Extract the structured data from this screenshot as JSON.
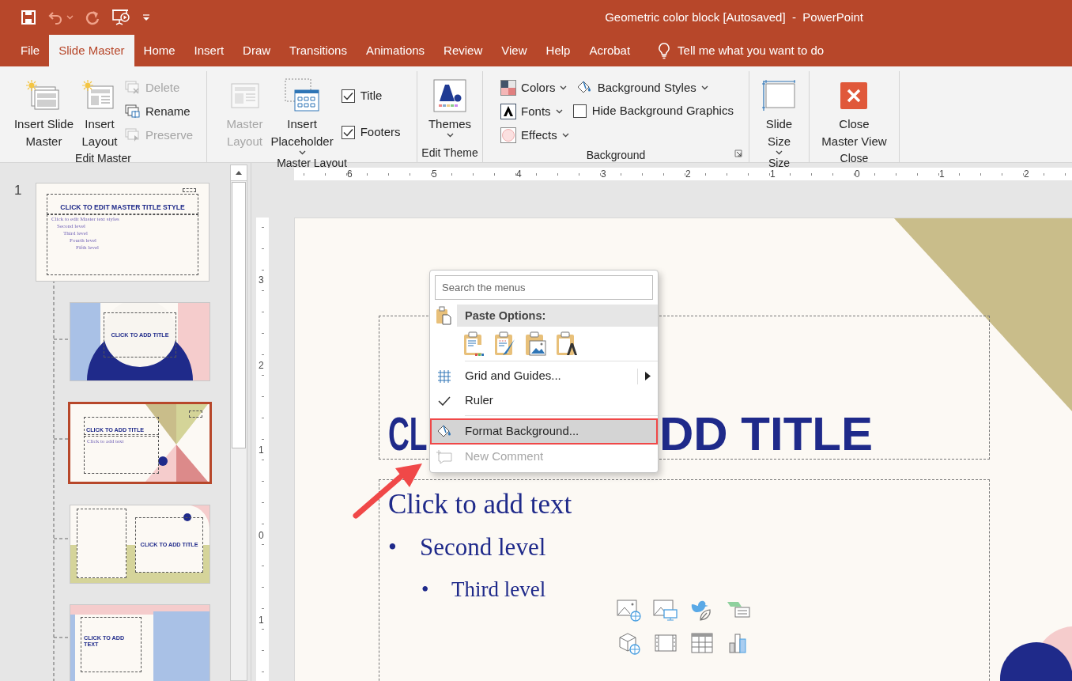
{
  "window": {
    "title": "Geometric color block [Autosaved]  -  PowerPoint"
  },
  "quick_access": [
    {
      "kind": "save",
      "disabled": false,
      "dropdown": false
    },
    {
      "kind": "undo",
      "disabled": true,
      "dropdown": true
    },
    {
      "kind": "redo",
      "disabled": true,
      "dropdown": false
    },
    {
      "kind": "present",
      "disabled": false,
      "dropdown": false
    },
    {
      "kind": "customize",
      "disabled": false,
      "dropdown": false
    }
  ],
  "tabs": [
    {
      "label": "File",
      "selected": false
    },
    {
      "label": "Slide Master",
      "selected": true
    },
    {
      "label": "Home",
      "selected": false
    },
    {
      "label": "Insert",
      "selected": false
    },
    {
      "label": "Draw",
      "selected": false
    },
    {
      "label": "Transitions",
      "selected": false
    },
    {
      "label": "Animations",
      "selected": false
    },
    {
      "label": "Review",
      "selected": false
    },
    {
      "label": "View",
      "selected": false
    },
    {
      "label": "Help",
      "selected": false
    },
    {
      "label": "Acrobat",
      "selected": false
    }
  ],
  "tell_me": "Tell me what you want to do",
  "ribbon": {
    "groups": [
      {
        "label": "Edit Master",
        "launcher": false,
        "columns": [
          [
            {
              "kind": "large",
              "lines": [
                "Insert Slide",
                "Master"
              ],
              "disabled": false,
              "dropdown": false
            }
          ],
          [
            {
              "kind": "large",
              "lines": [
                "Insert",
                "Layout"
              ],
              "disabled": false,
              "dropdown": false
            }
          ],
          [
            {
              "kind": "small",
              "label": "Delete",
              "disabled": true,
              "dropdown": false
            },
            {
              "kind": "small",
              "label": "Rename",
              "disabled": false,
              "dropdown": false
            },
            {
              "kind": "small",
              "label": "Preserve",
              "disabled": true,
              "dropdown": false
            }
          ]
        ]
      },
      {
        "label": "Master Layout",
        "launcher": false,
        "columns": [
          [
            {
              "kind": "large",
              "lines": [
                "Master",
                "Layout"
              ],
              "disabled": true,
              "dropdown": false
            }
          ],
          [
            {
              "kind": "large",
              "lines": [
                "Insert",
                "Placeholder"
              ],
              "disabled": false,
              "dropdown": true
            }
          ],
          [
            {
              "kind": "check",
              "label": "Title",
              "checked": true
            },
            {
              "kind": "check",
              "label": "Footers",
              "checked": true
            }
          ]
        ]
      },
      {
        "label": "Edit Theme",
        "launcher": false,
        "columns": [
          [
            {
              "kind": "large",
              "lines": [
                "Themes"
              ],
              "disabled": false,
              "dropdown": true
            }
          ]
        ]
      },
      {
        "label": "Background",
        "launcher": true,
        "columns": [
          [
            {
              "kind": "small",
              "label": "Colors",
              "disabled": false,
              "dropdown": true
            },
            {
              "kind": "small",
              "label": "Fonts",
              "disabled": false,
              "dropdown": true
            },
            {
              "kind": "small",
              "label": "Effects",
              "disabled": false,
              "dropdown": true
            }
          ],
          [
            {
              "kind": "small",
              "label": "Background Styles",
              "disabled": false,
              "dropdown": true
            },
            {
              "kind": "check",
              "label": "Hide Background Graphics",
              "checked": false
            }
          ]
        ]
      },
      {
        "label": "Size",
        "launcher": false,
        "columns": [
          [
            {
              "kind": "large",
              "lines": [
                "Slide",
                "Size"
              ],
              "disabled": false,
              "dropdown": true
            }
          ]
        ]
      },
      {
        "label": "Close",
        "launcher": false,
        "columns": [
          [
            {
              "kind": "large",
              "lines": [
                "Close",
                "Master View"
              ],
              "disabled": false,
              "dropdown": false
            }
          ]
        ]
      }
    ]
  },
  "slides": [
    {
      "number": "1",
      "kind": "master",
      "selected": false,
      "title": "CLICK TO EDIT MASTER TITLE STYLE",
      "levels": [
        "Click to edit Master text styles",
        "Second level",
        "Third level",
        "Fourth level",
        "Fifth level"
      ]
    },
    {
      "kind": "circle",
      "selected": false,
      "title": "CLICK TO ADD TITLE"
    },
    {
      "kind": "triangles",
      "selected": true,
      "title": "CLICK TO ADD TITLE",
      "body": "Click to add text"
    },
    {
      "kind": "columns",
      "selected": false,
      "title": "CLICK TO ADD TITLE"
    },
    {
      "kind": "panels",
      "selected": false,
      "title": "CLICK TO ADD TEXT"
    }
  ],
  "ruler": {
    "horizontal": [
      "6",
      "5",
      "4",
      "3",
      "2",
      "1",
      "0",
      "1",
      "2"
    ],
    "vertical": [
      "3",
      "2",
      "1",
      "0",
      "1"
    ]
  },
  "slide": {
    "title_parts": [
      "CL",
      "DD TITLE"
    ],
    "body": "Click to add text",
    "levels": [
      {
        "bullet": "•",
        "text": "Second level"
      },
      {
        "bullet": "•",
        "text": "Third level"
      }
    ]
  },
  "context_menu": {
    "search_placeholder": "Search the menus",
    "paste_header": "Paste Options:",
    "items": [
      {
        "kind": "submenu",
        "label": "Grid and Guides...",
        "checked": false,
        "selected": false,
        "disabled": false
      },
      {
        "kind": "check",
        "label": "Ruler",
        "checked": true,
        "selected": false,
        "disabled": false
      },
      {
        "kind": "plain",
        "label": "Format Background...",
        "checked": false,
        "selected": true,
        "disabled": false
      },
      {
        "kind": "plain",
        "label": "New Comment",
        "checked": false,
        "selected": false,
        "disabled": true
      }
    ]
  }
}
